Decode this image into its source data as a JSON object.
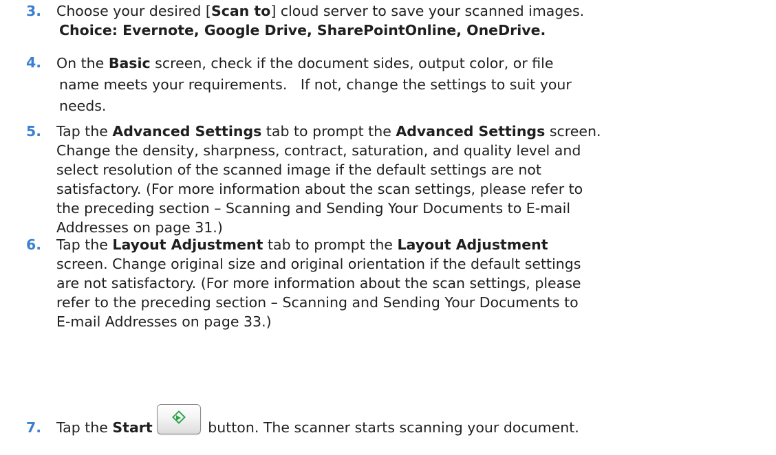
{
  "steps": [
    {
      "number": "3.",
      "lines": [
        {
          "t1": "Choose your desired [",
          "b1": "Scan to",
          "t2": "] cloud server to save your scanned images."
        },
        {
          "b1": "Choice: Evernote, Google Drive, SharePointOnline, OneDrive."
        }
      ]
    },
    {
      "number": "4.",
      "lines": [
        {
          "t1": "On the ",
          "b1": "Basic",
          "t2": " screen, check if the document sides, output color, or file"
        },
        {
          "t1": "name meets your requirements.   If not, change the settings to suit your"
        },
        {
          "t1": "needs."
        }
      ]
    },
    {
      "number": "5.",
      "lines": [
        {
          "t1": "Tap the ",
          "b1": "Advanced Settings",
          "t2": " tab to prompt the ",
          "b2": "Advanced Settings",
          "t3": " screen."
        },
        {
          "t1": "Change the density, sharpness, contract, saturation, and quality level and"
        },
        {
          "t1": "select resolution of the scanned image if the default settings are not"
        },
        {
          "t1": "satisfactory. (For more information about the scan settings, please refer to"
        },
        {
          "t1": "the preceding section – Scanning and Sending Your Documents to E-mail"
        },
        {
          "t1": "Addresses on page 31.)"
        }
      ]
    },
    {
      "number": "6.",
      "lines": [
        {
          "t1": "Tap the ",
          "b1": "Layout Adjustment",
          "t2": " tab to prompt the ",
          "b2": "Layout Adjustment"
        },
        {
          "t1": "screen. Change original size and original orientation if the default settings"
        },
        {
          "t1": "are not satisfactory. (For more information about the scan settings, please"
        },
        {
          "t1": "refer to the preceding section – Scanning and Sending Your Documents to"
        },
        {
          "t1": "E-mail Addresses on page 33.)"
        }
      ]
    },
    {
      "number": "7.",
      "lines": [
        {
          "t1": "Tap the ",
          "b1": "Start",
          "t2": " button. The scanner starts scanning your document."
        }
      ]
    }
  ],
  "start_button_icon": "start-diamond-icon",
  "colors": {
    "step_number": "#3b7fd0",
    "text": "#1f1f1f",
    "start_icon": "#2fa24a"
  }
}
